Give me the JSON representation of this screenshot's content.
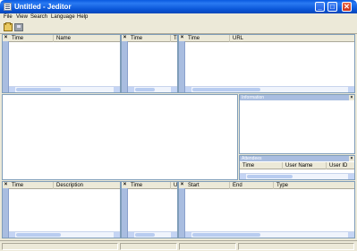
{
  "window": {
    "title": "Untitled - Jeditor",
    "minimize_label": "_",
    "maximize_label": "□",
    "close_label": "✕"
  },
  "menu": [
    "File",
    "View",
    "Search",
    "Language",
    "Help"
  ],
  "toolbar": {
    "icons": [
      "open-icon",
      "save-icon"
    ]
  },
  "panes": {
    "top_left": {
      "columns": [
        "Time",
        "Name"
      ]
    },
    "top_mid": {
      "columns": [
        "Time",
        "Tr"
      ]
    },
    "top_right": {
      "columns": [
        "Time",
        "URL"
      ]
    },
    "information": {
      "title": "Information"
    },
    "attendees": {
      "title": "Attendees",
      "columns": [
        "Time",
        "User Name",
        "User ID"
      ]
    },
    "bottom_left": {
      "columns": [
        "Time",
        "Description"
      ]
    },
    "bottom_mid": {
      "columns": [
        "Time",
        "U"
      ]
    },
    "bottom_right": {
      "columns": [
        "Start",
        "End",
        "Type"
      ]
    }
  },
  "close_glyph": "×",
  "colors": {
    "title_bar": "#0a56d8",
    "panel_chrome": "#a9bde0",
    "window_bg": "#ece9d8"
  }
}
